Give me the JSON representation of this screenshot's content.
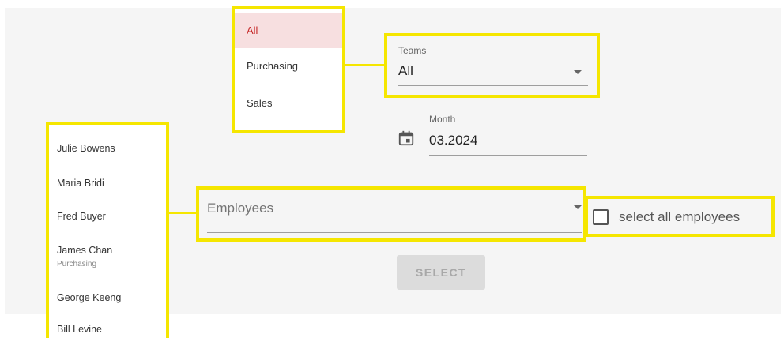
{
  "teams_menu": {
    "items": [
      {
        "label": "All",
        "selected": true
      },
      {
        "label": "Purchasing",
        "selected": false
      },
      {
        "label": "Sales",
        "selected": false
      }
    ]
  },
  "teams_select": {
    "label": "Teams",
    "value": "All"
  },
  "month_field": {
    "label": "Month",
    "value": "03.2024",
    "icon": "calendar-icon"
  },
  "employees_menu": {
    "items": [
      {
        "name": "Julie Bowens",
        "team": ""
      },
      {
        "name": "Maria Bridi",
        "team": ""
      },
      {
        "name": "Fred Buyer",
        "team": ""
      },
      {
        "name": "James Chan",
        "team": "Purchasing"
      },
      {
        "name": "George Keeng",
        "team": ""
      },
      {
        "name": "Bill Levine",
        "team": ""
      }
    ]
  },
  "employees_select": {
    "placeholder": "Employees"
  },
  "select_all": {
    "label": "select all employees",
    "checked": false
  },
  "select_button": {
    "label": "SELECT",
    "disabled": true
  },
  "colors": {
    "highlight": "#f5e600",
    "selected_text": "#c62828",
    "selected_bg": "#f7dfe0"
  }
}
